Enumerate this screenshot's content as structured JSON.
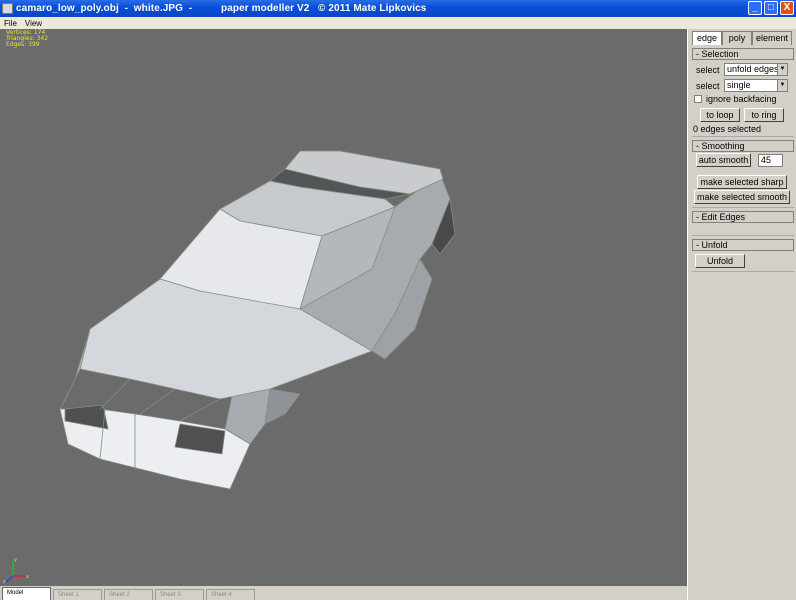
{
  "window": {
    "title": "camaro_low_poly.obj  -  white.JPG  -          paper modeller V2   © 2011 Mate Lipkovics",
    "minimize_label": "_",
    "maximize_label": "□",
    "close_label": "X"
  },
  "menu": {
    "items": [
      "File",
      "View"
    ]
  },
  "viewport": {
    "stats": [
      "Vertices: 174",
      "Triangles: 342",
      "Edges: 399"
    ],
    "axis_labels": {
      "y": "y",
      "x": "x",
      "z": "z"
    }
  },
  "sheet_tabs": [
    "Model",
    "Sheet 1",
    "Sheet 2",
    "Sheet 3",
    "Sheet 4"
  ],
  "panel": {
    "tabs": [
      "edge",
      "poly",
      "element"
    ],
    "selection": {
      "header": "- Selection",
      "select_label_1": "select",
      "select_value_1": "unfold edges",
      "select_label_2": "select",
      "select_value_2": "single",
      "ignore_backfacing": "ignore backfacing",
      "to_loop": "to loop",
      "to_ring": "to ring",
      "status": "0 edges selected"
    },
    "smoothing": {
      "header": "- Smoothing",
      "auto_smooth": "auto smooth",
      "angle": "45",
      "make_sharp": "make selected sharp",
      "make_smooth": "make selected smooth"
    },
    "edit_edges": {
      "header": "- Edit Edges"
    },
    "unfold": {
      "header": "- Unfold",
      "button": "Unfold"
    }
  },
  "colors": {
    "viewport_bg": "#6b6b6b",
    "stats_text": "#e6e62a",
    "panel_bg": "#d4d0c8",
    "titlebar": "#0b4fd8"
  }
}
